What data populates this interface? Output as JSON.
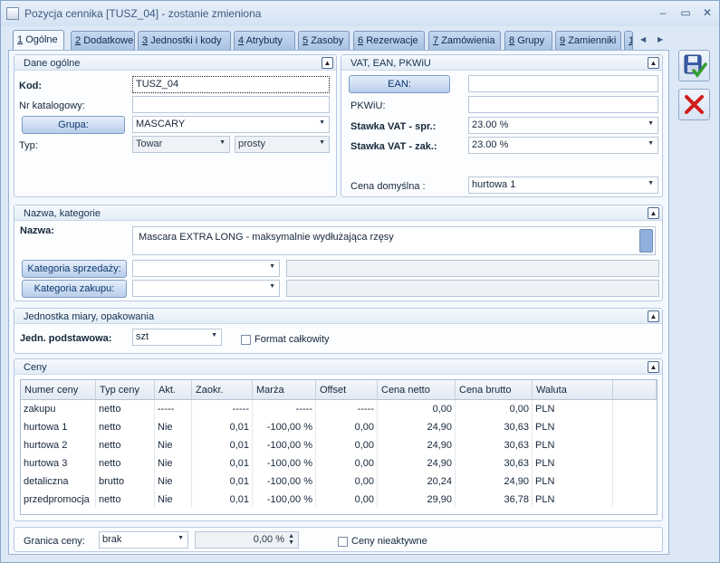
{
  "window": {
    "title": "Pozycja cennika [TUSZ_04] - zostanie zmieniona",
    "minimize": "–",
    "maximize": "▭",
    "close": "✕"
  },
  "tabs": [
    {
      "num": "1",
      "label": "Ogólne"
    },
    {
      "num": "2",
      "label": "Dodatkowe"
    },
    {
      "num": "3",
      "label": "Jednostki i kody"
    },
    {
      "num": "4",
      "label": "Atrybuty"
    },
    {
      "num": "5",
      "label": "Zasoby"
    },
    {
      "num": "6",
      "label": "Rezerwacje"
    },
    {
      "num": "7",
      "label": "Zamówienia"
    },
    {
      "num": "8",
      "label": "Grupy"
    },
    {
      "num": "9",
      "label": "Zamienniki"
    },
    {
      "num": "1",
      "label": ""
    }
  ],
  "general": {
    "header": "Dane ogólne",
    "kod_label": "Kod:",
    "kod_value": "TUSZ_04",
    "nrkat_label": "Nr katalogowy:",
    "nrkat_value": "",
    "grupa_button": "Grupa:",
    "grupa_value": "MASCARY",
    "typ_label": "Typ:",
    "typ_value1": "Towar",
    "typ_value2": "prosty"
  },
  "vat": {
    "header": "VAT, EAN, PKWiU",
    "ean_button": "EAN:",
    "ean_value": "",
    "pkwiu_label": "PKWiU:",
    "pkwiu_value": "",
    "vat_spr_label": "Stawka VAT - spr.:",
    "vat_spr_value": "23.00 %",
    "vat_zak_label": "Stawka VAT - zak.:",
    "vat_zak_value": "23.00 %",
    "cena_label": "Cena domyślna :",
    "cena_value": "hurtowa 1"
  },
  "names": {
    "header": "Nazwa, kategorie",
    "nazwa_label": "Nazwa:",
    "nazwa_value": "Mascara EXTRA LONG - maksymalnie wydłużająca rzęsy",
    "kat_sprz_button": "Kategoria sprzedaży:",
    "kat_zak_button": "Kategoria zakupu:"
  },
  "unit": {
    "header": "Jednostka miary, opakowania",
    "label": "Jedn. podstawowa:",
    "value": "szt",
    "format_label": "Format całkowity"
  },
  "prices": {
    "header": "Ceny",
    "columns": [
      "Numer ceny",
      "Typ ceny",
      "Akt.",
      "Zaokr.",
      "Marża",
      "Offset",
      "Cena netto",
      "Cena brutto",
      "Waluta"
    ],
    "rows": [
      [
        "zakupu",
        "netto",
        "-----",
        "-----",
        "-----",
        "-----",
        "0,00",
        "0,00",
        "PLN"
      ],
      [
        "hurtowa 1",
        "netto",
        "Nie",
        "0,01",
        "-100,00 %",
        "0,00",
        "24,90",
        "30,63",
        "PLN"
      ],
      [
        "hurtowa 2",
        "netto",
        "Nie",
        "0,01",
        "-100,00 %",
        "0,00",
        "24,90",
        "30,63",
        "PLN"
      ],
      [
        "hurtowa 3",
        "netto",
        "Nie",
        "0,01",
        "-100,00 %",
        "0,00",
        "24,90",
        "30,63",
        "PLN"
      ],
      [
        "detaliczna",
        "brutto",
        "Nie",
        "0,01",
        "-100,00 %",
        "0,00",
        "20,24",
        "24,90",
        "PLN"
      ],
      [
        "przedpromocja",
        "netto",
        "Nie",
        "0,01",
        "-100,00 %",
        "0,00",
        "29,90",
        "36,78",
        "PLN"
      ]
    ]
  },
  "bottom": {
    "granica_label": "Granica ceny:",
    "granica_value": "brak",
    "percent_value": "0,00 %",
    "nieaktywne_label": "Ceny nieaktywne"
  }
}
